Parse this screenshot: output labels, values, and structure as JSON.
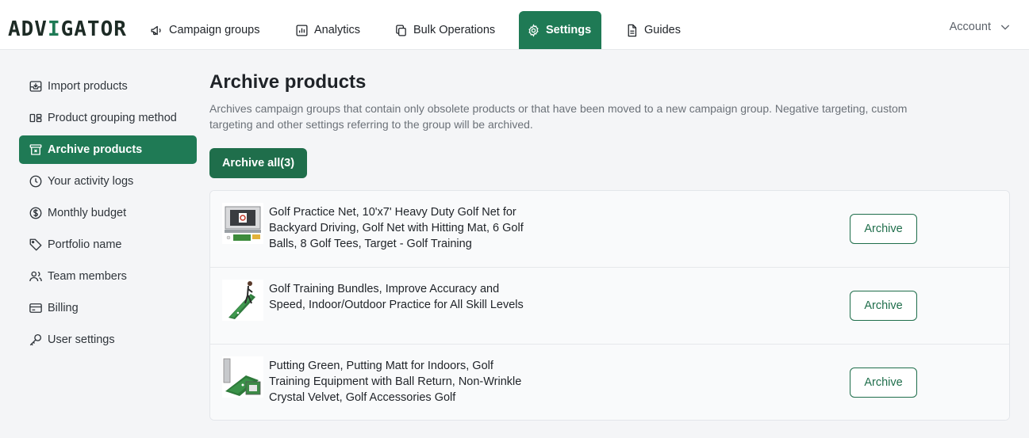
{
  "header": {
    "logo": {
      "prefix": "ADV",
      "accent": "I",
      "suffix": "GATOR"
    },
    "nav": [
      {
        "label": "Campaign groups",
        "icon": "megaphone-icon"
      },
      {
        "label": "Analytics",
        "icon": "bar-chart-icon"
      },
      {
        "label": "Bulk Operations",
        "icon": "copy-icon"
      },
      {
        "label": "Settings",
        "icon": "gear-icon",
        "active": true
      },
      {
        "label": "Guides",
        "icon": "document-icon"
      }
    ],
    "account_label": "Account"
  },
  "sidebar": {
    "items": [
      {
        "label": "Import products",
        "icon": "inbox-icon"
      },
      {
        "label": "Product grouping method",
        "icon": "grouping-icon"
      },
      {
        "label": "Archive products",
        "icon": "archive-icon",
        "active": true
      },
      {
        "label": "Your activity logs",
        "icon": "clock-icon"
      },
      {
        "label": "Monthly budget",
        "icon": "dollar-icon"
      },
      {
        "label": "Portfolio name",
        "icon": "tag-icon"
      },
      {
        "label": "Team members",
        "icon": "users-icon"
      },
      {
        "label": "Billing",
        "icon": "credit-card-icon"
      },
      {
        "label": "User settings",
        "icon": "key-icon"
      }
    ]
  },
  "main": {
    "title": "Archive products",
    "description": "Archives campaign groups that contain only obsolete products or that have been moved to a new campaign group. Negative targeting, custom targeting and other settings referring to the group will be archived.",
    "archive_all_label": "Archive all(3)",
    "products": [
      {
        "title": "Golf Practice Net, 10'x7' Heavy Duty Golf Net for Backyard Driving, Golf Net with Hitting Mat, 6 Golf Balls, 8 Golf Tees, Target - Golf Training",
        "button": "Archive"
      },
      {
        "title": "Golf Training Bundles, Improve Accuracy and Speed, Indoor/Outdoor Practice for All Skill Levels",
        "button": "Archive"
      },
      {
        "title": "Putting Green, Putting Matt for Indoors, Golf Training Equipment with Ball Return, Non-Wrinkle Crystal Velvet, Golf Accessories Golf",
        "button": "Archive"
      }
    ]
  },
  "colors": {
    "brand_green": "#1f7a55",
    "button_green": "#1f6e4b",
    "page_bg": "#f4f5f7"
  }
}
